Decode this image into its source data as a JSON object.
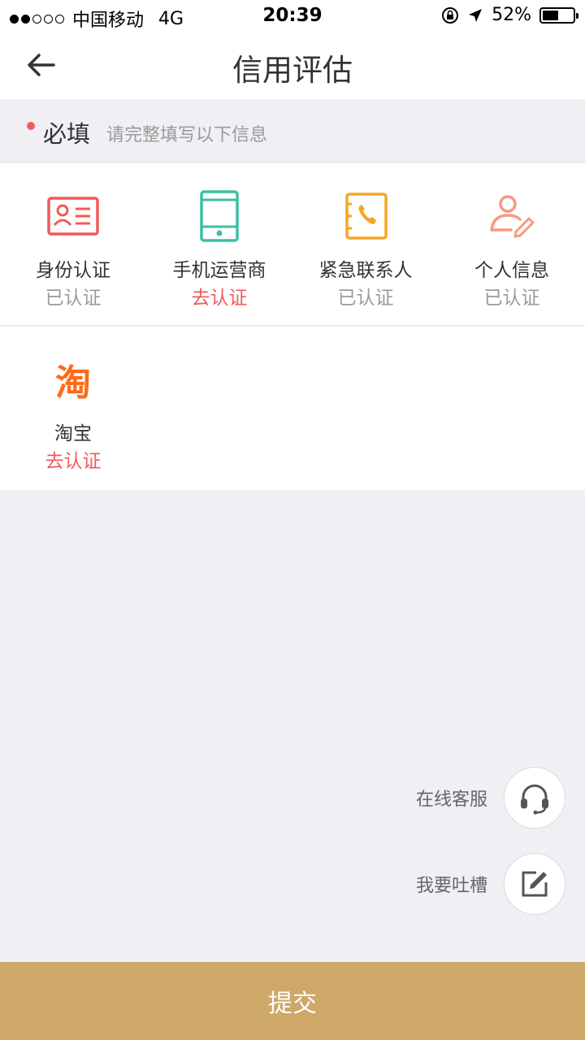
{
  "status_bar": {
    "carrier": "中国移动",
    "network": "4G",
    "time": "20:39",
    "battery": "52%",
    "battery_level": 0.52
  },
  "nav": {
    "title": "信用评估",
    "back_icon": "arrow-left-icon"
  },
  "required": {
    "label": "必填",
    "hint": "请完整填写以下信息",
    "dot_color": "#f25a5a"
  },
  "items": [
    {
      "label": "身份认证",
      "status": "已认证",
      "icon": "id-card-icon",
      "color": "#f05a5a"
    },
    {
      "label": "手机运营商",
      "status": "去认证",
      "icon": "mobile-phone-icon",
      "color": "#3cc0a4"
    },
    {
      "label": "紧急联系人",
      "status": "已认证",
      "icon": "contacts-book-icon",
      "color": "#f5a623"
    },
    {
      "label": "个人信息",
      "status": "已认证",
      "icon": "person-edit-icon",
      "color": "#f89a80"
    },
    {
      "label": "淘宝",
      "status": "去认证",
      "icon": "taobao-icon",
      "icon_text": "淘",
      "color": "#ff6a1a"
    }
  ],
  "float": {
    "service_label": "在线客服",
    "feedback_label": "我要吐槽"
  },
  "submit_label": "提交",
  "colors": {
    "accent": "#cda869",
    "verified": "#9a9a9a",
    "unverified": "#f25a5a"
  }
}
